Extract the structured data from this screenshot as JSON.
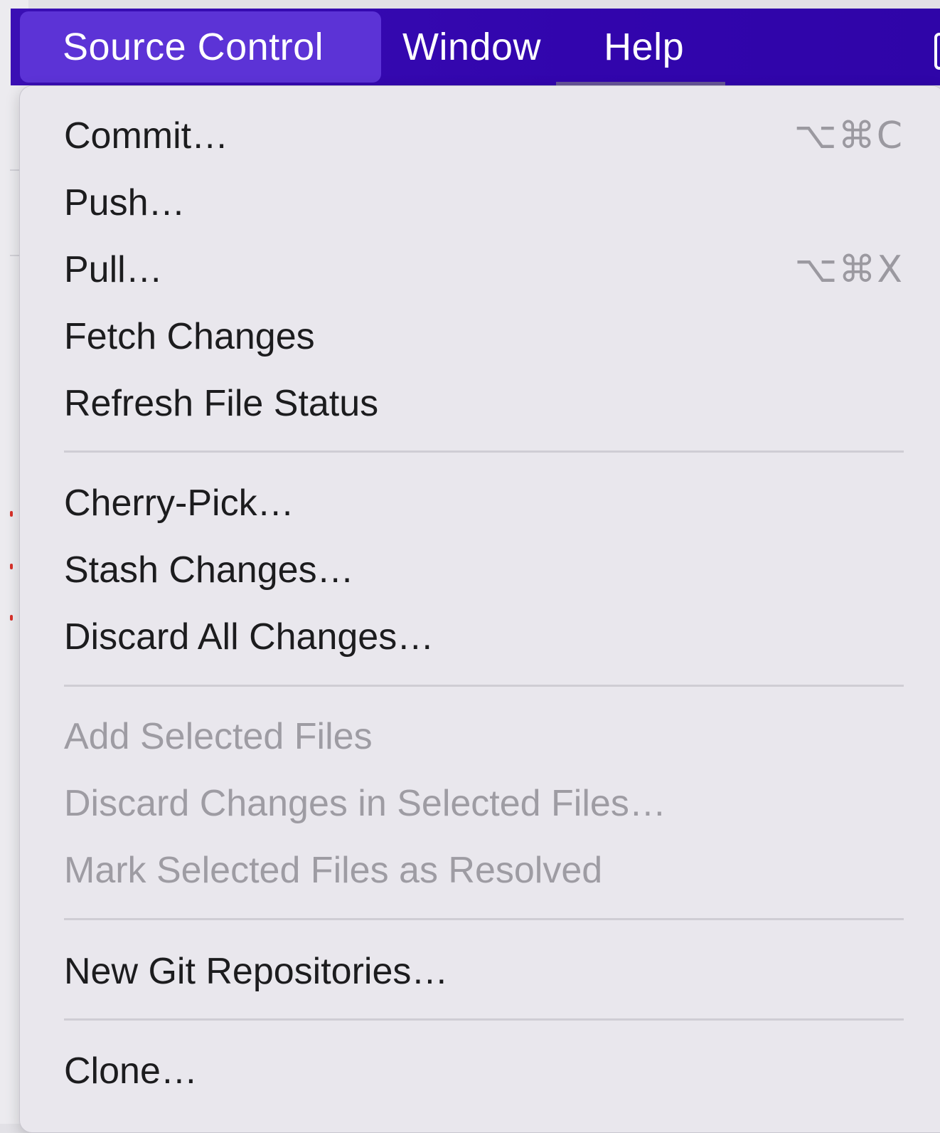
{
  "menubar": {
    "items": [
      "Source Control",
      "Window",
      "Help"
    ]
  },
  "menu": {
    "groups": [
      [
        {
          "label": "Commit…",
          "shortcut": "⌥⌘C",
          "enabled": true
        },
        {
          "label": "Push…",
          "shortcut": "",
          "enabled": true
        },
        {
          "label": "Pull…",
          "shortcut": "⌥⌘X",
          "enabled": true
        },
        {
          "label": "Fetch Changes",
          "shortcut": "",
          "enabled": true
        },
        {
          "label": "Refresh File Status",
          "shortcut": "",
          "enabled": true
        }
      ],
      [
        {
          "label": "Cherry-Pick…",
          "shortcut": "",
          "enabled": true
        },
        {
          "label": "Stash Changes…",
          "shortcut": "",
          "enabled": true
        },
        {
          "label": "Discard All Changes…",
          "shortcut": "",
          "enabled": true
        }
      ],
      [
        {
          "label": "Add Selected Files",
          "shortcut": "",
          "enabled": false
        },
        {
          "label": "Discard Changes in Selected Files…",
          "shortcut": "",
          "enabled": false
        },
        {
          "label": "Mark Selected Files as Resolved",
          "shortcut": "",
          "enabled": false
        }
      ],
      [
        {
          "label": "New Git Repositories…",
          "shortcut": "",
          "enabled": true
        }
      ],
      [
        {
          "label": "Clone…",
          "shortcut": "",
          "enabled": true
        }
      ]
    ]
  },
  "colors": {
    "menubar": "#3205ad",
    "menubar_active": "#5c33d6",
    "menu_bg": "#e9e7ed",
    "text": "#1c1c1e",
    "disabled_text": "#9e9ca3"
  }
}
